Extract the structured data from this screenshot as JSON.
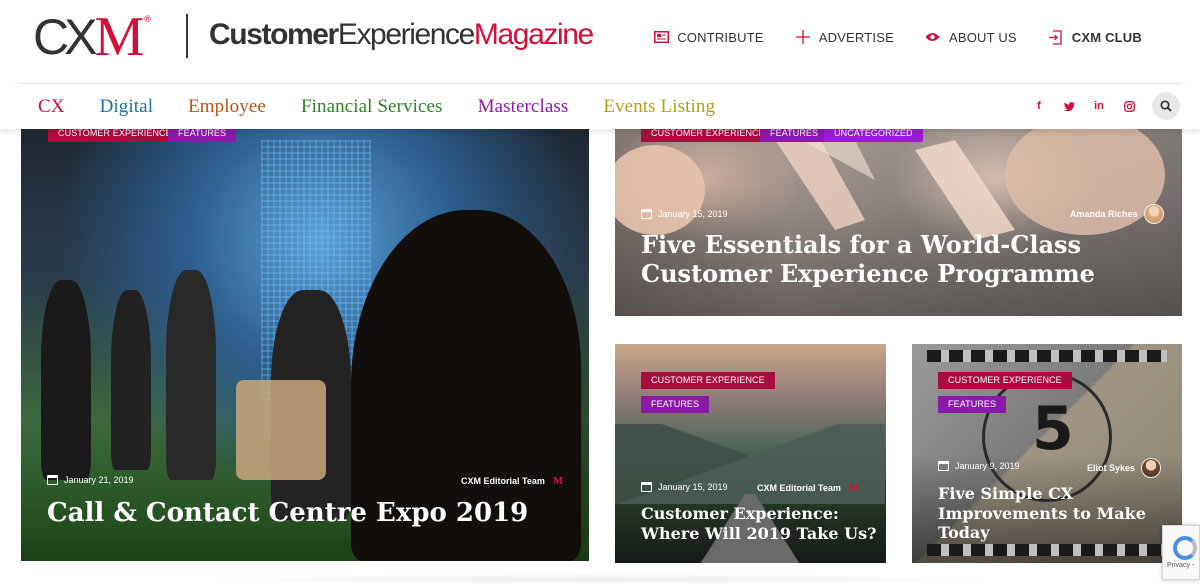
{
  "header": {
    "logo_cx": "CX",
    "logo_m": "M",
    "logo_reg": "®",
    "logo_text_customer": "Customer",
    "logo_text_experience": "Experience",
    "logo_text_magazine": "Magazine",
    "links": [
      {
        "label": "CONTRIBUTE",
        "icon": "newspaper-icon"
      },
      {
        "label": "ADVERTISE",
        "icon": "plus-icon"
      },
      {
        "label": "ABOUT US",
        "icon": "eye-icon"
      },
      {
        "label": "CXM CLUB",
        "icon": "login-icon"
      }
    ]
  },
  "nav": {
    "items": [
      {
        "label": "CX",
        "color": "#d0103a"
      },
      {
        "label": "Digital",
        "color": "#1c6fa4"
      },
      {
        "label": "Employee",
        "color": "#b85418"
      },
      {
        "label": "Financial Services",
        "color": "#2f7f2c"
      },
      {
        "label": "Masterclass",
        "color": "#8c1aa8"
      },
      {
        "label": "Events Listing",
        "color": "#b0a017"
      }
    ],
    "social": [
      "facebook-icon",
      "twitter-icon",
      "linkedin-icon",
      "instagram-icon"
    ],
    "search_icon": "search-icon"
  },
  "tags": {
    "cx": "CUSTOMER EXPERIENCE",
    "features": "FEATURES",
    "uncategorized": "UNCATEGORIZED"
  },
  "articles": [
    {
      "date": "January 21, 2019",
      "author": "CXM Editorial Team",
      "author_mark": "M",
      "title": "Call & Contact Centre Expo 2019"
    },
    {
      "date": "January 15, 2019",
      "author": "Amanda Riches",
      "title": "Five Essentials for a World-Class Customer Experience Programme"
    },
    {
      "date": "January 15, 2019",
      "author": "CXM Editorial Team",
      "author_mark": "M",
      "title": "Customer Experience: Where Will 2019 Take Us?"
    },
    {
      "date": "January 9, 2019",
      "author": "Eliot Sykes",
      "title": "Five Simple CX Improvements to Make Today"
    }
  ],
  "recaptcha": {
    "text": "Privacy -"
  },
  "colors": {
    "brand": "#d0103a",
    "cx_tag": "#a80d3d",
    "features_tag": "#8c1aa8",
    "uncategorized_tag": "#9a1fd1"
  }
}
